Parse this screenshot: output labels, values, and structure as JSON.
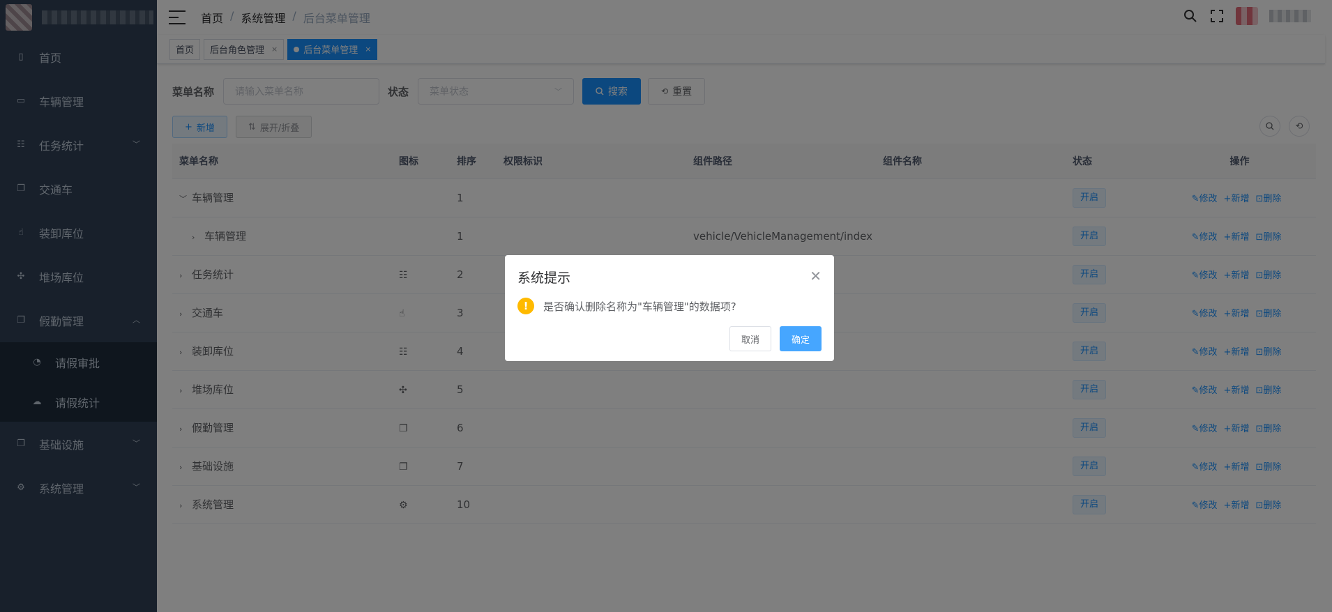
{
  "sidebar": {
    "items": [
      {
        "label": "首页",
        "icon": "home-icon",
        "glyph": "▯"
      },
      {
        "label": "车辆管理",
        "icon": "car-icon",
        "glyph": "▭"
      },
      {
        "label": "任务统计",
        "icon": "tree-icon",
        "glyph": "☷",
        "arrow": "﹀"
      },
      {
        "label": "交通车",
        "icon": "documents-icon",
        "glyph": "❐"
      },
      {
        "label": "装卸库位",
        "icon": "hand-icon",
        "glyph": "☝"
      },
      {
        "label": "堆场库位",
        "icon": "puzzle-icon",
        "glyph": "✣"
      },
      {
        "label": "假勤管理",
        "icon": "documents-icon",
        "glyph": "❐",
        "arrow": "︿"
      }
    ],
    "sub_items": [
      {
        "label": "请假审批",
        "icon": "clock-icon",
        "glyph": "◔"
      },
      {
        "label": "请假统计",
        "icon": "cloud-icon",
        "glyph": "☁"
      }
    ],
    "bottom_items": [
      {
        "label": "基础设施",
        "icon": "documents-icon",
        "glyph": "❐",
        "arrow": "﹀"
      },
      {
        "label": "系统管理",
        "icon": "gear-icon",
        "glyph": "⚙",
        "arrow": "﹀"
      }
    ]
  },
  "navbar": {
    "breadcrumb": [
      "首页",
      "系统管理",
      "后台菜单管理"
    ],
    "separator": "/"
  },
  "tags": [
    {
      "label": "首页",
      "closable": false,
      "active": false
    },
    {
      "label": "后台角色管理",
      "closable": true,
      "active": false
    },
    {
      "label": "后台菜单管理",
      "closable": true,
      "active": true
    }
  ],
  "search": {
    "name_label": "菜单名称",
    "name_placeholder": "请输入菜单名称",
    "status_label": "状态",
    "status_placeholder": "菜单状态",
    "search_btn": "搜索",
    "reset_btn": "重置"
  },
  "toolbar": {
    "add_btn": "新增",
    "toggle_btn": "展开/折叠"
  },
  "table": {
    "headers": [
      "菜单名称",
      "图标",
      "排序",
      "权限标识",
      "组件路径",
      "组件名称",
      "状态",
      "操作"
    ],
    "rows": [
      {
        "name": "车辆管理",
        "expander": "﹀",
        "indent": 0,
        "icon": "",
        "order": "1",
        "perm": "",
        "path": "",
        "comp": "",
        "status": "开启"
      },
      {
        "name": "车辆管理",
        "expander": "›",
        "indent": 1,
        "icon": "",
        "order": "1",
        "perm": "",
        "path": "vehicle/VehicleManagement/index",
        "comp": "",
        "status": "开启"
      },
      {
        "name": "任务统计",
        "expander": "›",
        "indent": 0,
        "icon": "☷",
        "order": "2",
        "perm": "",
        "path": "",
        "comp": "",
        "status": "开启"
      },
      {
        "name": "交通车",
        "expander": "›",
        "indent": 0,
        "icon": "☝",
        "order": "3",
        "perm": "",
        "path": "",
        "comp": "",
        "status": "开启"
      },
      {
        "name": "装卸库位",
        "expander": "›",
        "indent": 0,
        "icon": "☷",
        "order": "4",
        "perm": "",
        "path": "",
        "comp": "",
        "status": "开启"
      },
      {
        "name": "堆场库位",
        "expander": "›",
        "indent": 0,
        "icon": "✣",
        "order": "5",
        "perm": "",
        "path": "",
        "comp": "",
        "status": "开启"
      },
      {
        "name": "假勤管理",
        "expander": "›",
        "indent": 0,
        "icon": "❐",
        "order": "6",
        "perm": "",
        "path": "",
        "comp": "",
        "status": "开启"
      },
      {
        "name": "基础设施",
        "expander": "›",
        "indent": 0,
        "icon": "❐",
        "order": "7",
        "perm": "",
        "path": "",
        "comp": "",
        "status": "开启"
      },
      {
        "name": "系统管理",
        "expander": "›",
        "indent": 0,
        "icon": "⚙",
        "order": "10",
        "perm": "",
        "path": "",
        "comp": "",
        "status": "开启"
      }
    ],
    "ops": [
      "修改",
      "新增",
      "删除"
    ]
  },
  "dialog": {
    "title": "系统提示",
    "message": "是否确认删除名称为\"车辆管理\"的数据项?",
    "cancel": "取消",
    "confirm": "确定"
  }
}
